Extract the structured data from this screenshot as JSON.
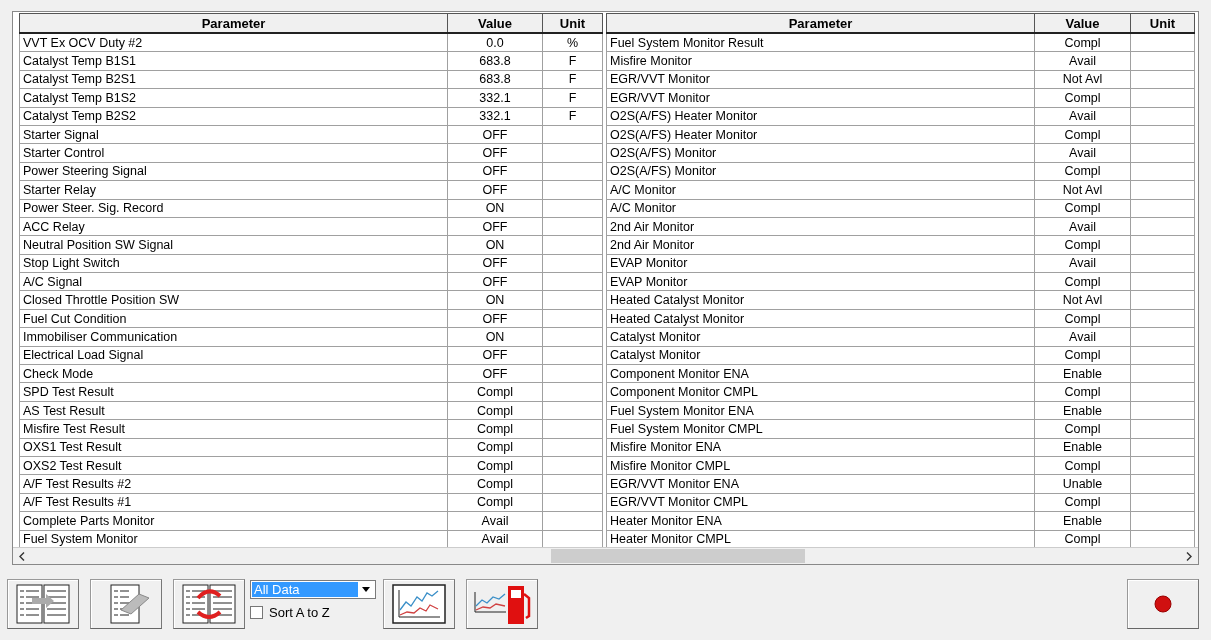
{
  "tables": [
    {
      "columns": [
        "Parameter",
        "Value",
        "Unit"
      ],
      "rows": [
        [
          "VVT Ex OCV Duty #2",
          "0.0",
          "%"
        ],
        [
          "Catalyst Temp B1S1",
          "683.8",
          "F"
        ],
        [
          "Catalyst Temp B2S1",
          "683.8",
          "F"
        ],
        [
          "Catalyst Temp B1S2",
          "332.1",
          "F"
        ],
        [
          "Catalyst Temp B2S2",
          "332.1",
          "F"
        ],
        [
          "Starter Signal",
          "OFF",
          ""
        ],
        [
          "Starter Control",
          "OFF",
          ""
        ],
        [
          "Power Steering Signal",
          "OFF",
          ""
        ],
        [
          "Starter Relay",
          "OFF",
          ""
        ],
        [
          "Power Steer. Sig. Record",
          "ON",
          ""
        ],
        [
          "ACC Relay",
          "OFF",
          ""
        ],
        [
          "Neutral Position SW Signal",
          "ON",
          ""
        ],
        [
          "Stop Light Switch",
          "OFF",
          ""
        ],
        [
          "A/C Signal",
          "OFF",
          ""
        ],
        [
          "Closed Throttle Position SW",
          "ON",
          ""
        ],
        [
          "Fuel Cut Condition",
          "OFF",
          ""
        ],
        [
          "Immobiliser Communication",
          "ON",
          ""
        ],
        [
          "Electrical Load Signal",
          "OFF",
          ""
        ],
        [
          "Check Mode",
          "OFF",
          ""
        ],
        [
          "SPD Test Result",
          "Compl",
          ""
        ],
        [
          "AS Test Result",
          "Compl",
          ""
        ],
        [
          "Misfire Test Result",
          "Compl",
          ""
        ],
        [
          "OXS1 Test Result",
          "Compl",
          ""
        ],
        [
          "OXS2 Test Result",
          "Compl",
          ""
        ],
        [
          "A/F Test Results #2",
          "Compl",
          ""
        ],
        [
          "A/F Test Results #1",
          "Compl",
          ""
        ],
        [
          "Complete Parts Monitor",
          "Avail",
          ""
        ],
        [
          "Fuel System Monitor",
          "Avail",
          ""
        ]
      ]
    },
    {
      "columns": [
        "Parameter",
        "Value",
        "Unit"
      ],
      "rows": [
        [
          "Fuel System Monitor Result",
          "Compl",
          ""
        ],
        [
          "Misfire Monitor",
          "Avail",
          ""
        ],
        [
          "EGR/VVT Monitor",
          "Not Avl",
          ""
        ],
        [
          "EGR/VVT Monitor",
          "Compl",
          ""
        ],
        [
          "O2S(A/FS) Heater Monitor",
          "Avail",
          ""
        ],
        [
          "O2S(A/FS) Heater Monitor",
          "Compl",
          ""
        ],
        [
          "O2S(A/FS) Monitor",
          "Avail",
          ""
        ],
        [
          "O2S(A/FS) Monitor",
          "Compl",
          ""
        ],
        [
          "A/C Monitor",
          "Not Avl",
          ""
        ],
        [
          "A/C Monitor",
          "Compl",
          ""
        ],
        [
          "2nd Air Monitor",
          "Avail",
          ""
        ],
        [
          "2nd Air Monitor",
          "Compl",
          ""
        ],
        [
          "EVAP Monitor",
          "Avail",
          ""
        ],
        [
          "EVAP Monitor",
          "Compl",
          ""
        ],
        [
          "Heated Catalyst Monitor",
          "Not Avl",
          ""
        ],
        [
          "Heated Catalyst Monitor",
          "Compl",
          ""
        ],
        [
          "Catalyst Monitor",
          "Avail",
          ""
        ],
        [
          "Catalyst Monitor",
          "Compl",
          ""
        ],
        [
          "Component Monitor ENA",
          "Enable",
          ""
        ],
        [
          "Component Monitor CMPL",
          "Compl",
          ""
        ],
        [
          "Fuel System Monitor ENA",
          "Enable",
          ""
        ],
        [
          "Fuel System Monitor CMPL",
          "Compl",
          ""
        ],
        [
          "Misfire Monitor ENA",
          "Enable",
          ""
        ],
        [
          "Misfire Monitor CMPL",
          "Compl",
          ""
        ],
        [
          "EGR/VVT Monitor ENA",
          "Unable",
          ""
        ],
        [
          "EGR/VVT Monitor CMPL",
          "Compl",
          ""
        ],
        [
          "Heater Monitor ENA",
          "Enable",
          ""
        ],
        [
          "Heater Monitor CMPL",
          "Compl",
          ""
        ]
      ]
    }
  ],
  "toolbar": {
    "dropdown": {
      "value": "All Data"
    },
    "sort_checkbox": {
      "label": "Sort A to Z",
      "checked": false
    }
  }
}
